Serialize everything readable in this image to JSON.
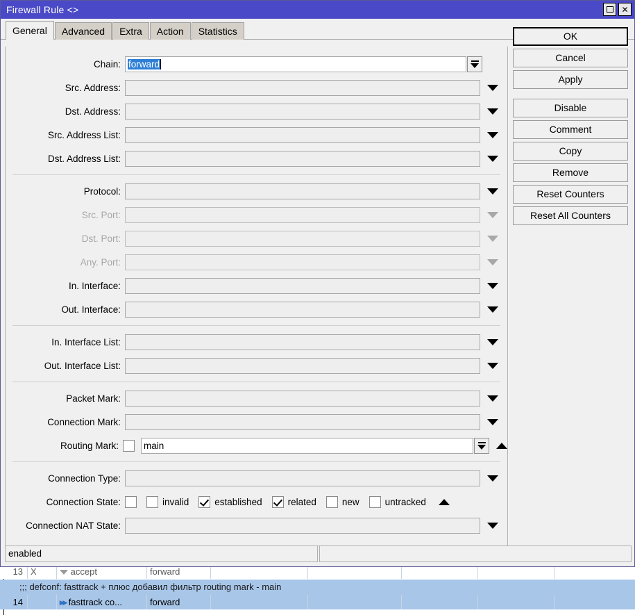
{
  "window": {
    "title": "Firewall Rule <>",
    "controls": [
      {
        "name": "maximize",
        "glyph": "square"
      },
      {
        "name": "close",
        "glyph": "✕"
      }
    ]
  },
  "tabs": [
    {
      "label": "General",
      "active": true
    },
    {
      "label": "Advanced",
      "active": false
    },
    {
      "label": "Extra",
      "active": false
    },
    {
      "label": "Action",
      "active": false
    },
    {
      "label": "Statistics",
      "active": false
    }
  ],
  "form": {
    "chain": {
      "label": "Chain:",
      "value": "forward",
      "selected": true
    },
    "src_address": {
      "label": "Src. Address:",
      "value": ""
    },
    "dst_address": {
      "label": "Dst. Address:",
      "value": ""
    },
    "src_address_list": {
      "label": "Src. Address List:",
      "value": ""
    },
    "dst_address_list": {
      "label": "Dst. Address List:",
      "value": ""
    },
    "protocol": {
      "label": "Protocol:",
      "value": ""
    },
    "src_port": {
      "label": "Src. Port:",
      "value": "",
      "disabled": true
    },
    "dst_port": {
      "label": "Dst. Port:",
      "value": "",
      "disabled": true
    },
    "any_port": {
      "label": "Any. Port:",
      "value": "",
      "disabled": true
    },
    "in_interface": {
      "label": "In. Interface:",
      "value": ""
    },
    "out_interface": {
      "label": "Out. Interface:",
      "value": ""
    },
    "in_interface_list": {
      "label": "In. Interface List:",
      "value": ""
    },
    "out_interface_list": {
      "label": "Out. Interface List:",
      "value": ""
    },
    "packet_mark": {
      "label": "Packet Mark:",
      "value": ""
    },
    "connection_mark": {
      "label": "Connection Mark:",
      "value": ""
    },
    "routing_mark": {
      "label": "Routing Mark:",
      "value": "main",
      "negate_checked": false
    },
    "connection_type": {
      "label": "Connection Type:",
      "value": ""
    },
    "connection_state": {
      "label": "Connection State:",
      "negate_checked": false,
      "options": [
        {
          "label": "invalid",
          "checked": false
        },
        {
          "label": "established",
          "checked": true
        },
        {
          "label": "related",
          "checked": true
        },
        {
          "label": "new",
          "checked": false
        },
        {
          "label": "untracked",
          "checked": false
        }
      ]
    },
    "connection_nat_state": {
      "label": "Connection NAT State:",
      "value": ""
    }
  },
  "buttons": [
    {
      "label": "OK",
      "primary": true,
      "gap": false
    },
    {
      "label": "Cancel",
      "primary": false,
      "gap": false
    },
    {
      "label": "Apply",
      "primary": false,
      "gap": false
    },
    {
      "label": "Disable",
      "primary": false,
      "gap": true
    },
    {
      "label": "Comment",
      "primary": false,
      "gap": false
    },
    {
      "label": "Copy",
      "primary": false,
      "gap": false
    },
    {
      "label": "Remove",
      "primary": false,
      "gap": false
    },
    {
      "label": "Reset Counters",
      "primary": false,
      "gap": false
    },
    {
      "label": "Reset All Counters",
      "primary": false,
      "gap": false
    }
  ],
  "statusbar": {
    "left": "enabled",
    "right": ""
  },
  "background_list": {
    "clipped_row": {
      "num": "13",
      "flag": "X",
      "action": "accept",
      "chain": "forward"
    },
    "comment_row": ";;; defconf: fasttrack + плюс добавил фильтр routing mark - main",
    "rule_row": {
      "num": "14",
      "flag": "",
      "action": "fasttrack co...",
      "chain": "forward"
    }
  },
  "colors": {
    "titlebar": "#4a4ac8",
    "dialog_bg": "#f0f0f0",
    "selection": "#2d7fd6",
    "row_selected": "#a8c6e8",
    "chevron": "#2f72c4"
  }
}
